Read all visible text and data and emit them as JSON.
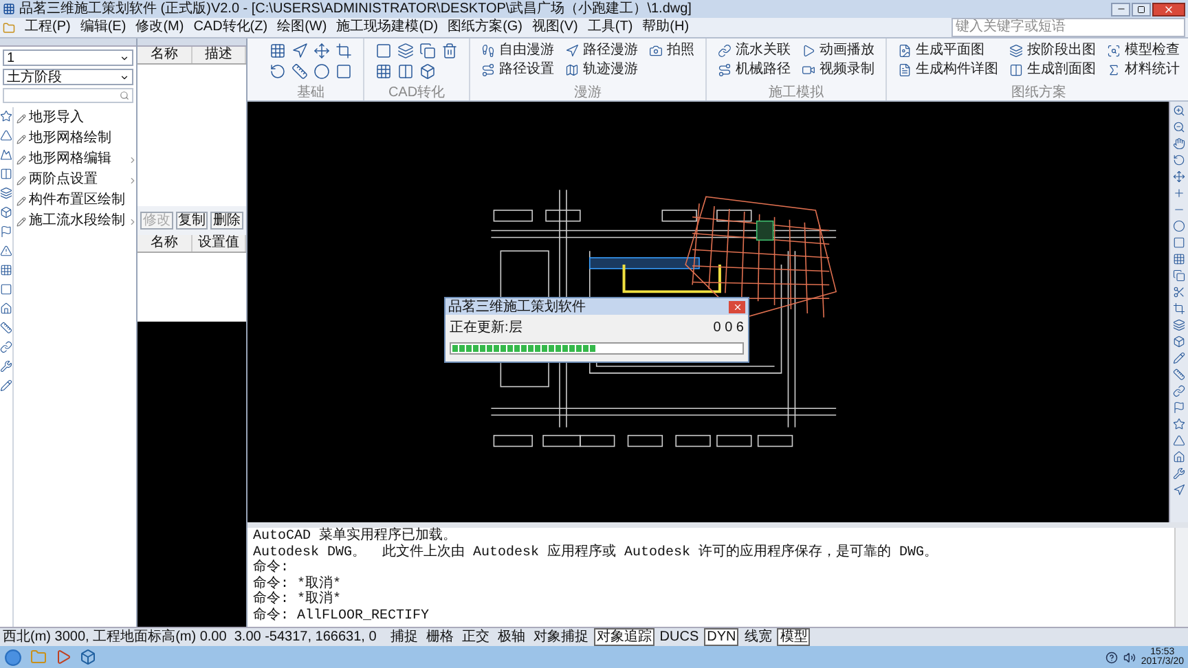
{
  "window": {
    "title": "品茗三维施工策划软件 (正式版)V2.0 - [C:\\USERS\\ADMINISTRATOR\\DESKTOP\\武昌广场（小跑建工）\\1.dwg]"
  },
  "menu": [
    "工程(P)",
    "编辑(E)",
    "修改(M)",
    "CAD转化(Z)",
    "绘图(W)",
    "施工现场建模(D)",
    "图纸方案(G)",
    "视图(V)",
    "工具(T)",
    "帮助(H)"
  ],
  "search": {
    "placeholder": "键入关键字或短语"
  },
  "left_panel": {
    "dropdowns": [
      "1",
      "土方阶段"
    ],
    "items": [
      {
        "label": "地形导入",
        "has_submenu": false
      },
      {
        "label": "地形网格绘制",
        "has_submenu": false
      },
      {
        "label": "地形网格编辑",
        "has_submenu": true
      },
      {
        "label": "两阶点设置",
        "has_submenu": true
      },
      {
        "label": "构件布置区绘制",
        "has_submenu": false
      },
      {
        "label": "施工流水段绘制",
        "has_submenu": true
      }
    ]
  },
  "property_panel": {
    "columns": [
      "名称",
      "描述"
    ],
    "buttons": [
      {
        "label": "修改",
        "disabled": true
      },
      {
        "label": "复制",
        "disabled": false
      },
      {
        "label": "删除",
        "disabled": false
      }
    ],
    "settings_columns": [
      "名称",
      "设置值"
    ]
  },
  "ribbon": {
    "groups": [
      {
        "title": "基础",
        "kind": "icons"
      },
      {
        "title": "CAD转化",
        "kind": "icons"
      },
      {
        "title": "漫游",
        "kind": "labeled",
        "items": [
          {
            "label": "自由漫游"
          },
          {
            "label": "路径设置"
          },
          {
            "label": "路径漫游"
          },
          {
            "label": "轨迹漫游"
          },
          {
            "label": "拍照"
          }
        ]
      },
      {
        "title": "施工模拟",
        "kind": "labeled",
        "items": [
          {
            "label": "流水关联"
          },
          {
            "label": "机械路径"
          },
          {
            "label": "动画播放"
          },
          {
            "label": "视频录制"
          }
        ]
      },
      {
        "title": "图纸方案",
        "kind": "labeled",
        "items": [
          {
            "label": "生成平面图"
          },
          {
            "label": "生成构件详图"
          },
          {
            "label": "按阶段出图"
          },
          {
            "label": "生成剖面图"
          },
          {
            "label": "模型检查"
          },
          {
            "label": "材料统计"
          }
        ]
      }
    ]
  },
  "dialog": {
    "title": "品茗三维施工策划软件",
    "status": "正在更新:层",
    "counter": "0 0 6",
    "level": 0.5
  },
  "command_lines": [
    "AutoCAD 菜单实用程序已加载。",
    "Autodesk DWG。  此文件上次由 Autodesk 应用程序或 Autodesk 许可的应用程序保存，是可靠的 DWG。",
    "命令:",
    "命令: *取消*",
    "命令: *取消*",
    "命令: AllFLOOR_RECTIFY"
  ],
  "status_bar": {
    "coords": "西北(m) 3000, 工程地面标高(m) 0.00  3.00 -54317, 166631, 0",
    "toggles": [
      {
        "label": "捕捉",
        "on": false
      },
      {
        "label": "栅格",
        "on": false
      },
      {
        "label": "正交",
        "on": false
      },
      {
        "label": "极轴",
        "on": false
      },
      {
        "label": "对象捕捉",
        "on": false
      },
      {
        "label": "对象追踪",
        "on": true
      },
      {
        "label": "DUCS",
        "on": false
      },
      {
        "label": "DYN",
        "on": true
      },
      {
        "label": "线宽",
        "on": false
      },
      {
        "label": "模型",
        "on": true
      }
    ]
  },
  "taskbar": {
    "time": "15:53",
    "date": "2017/3/20"
  }
}
